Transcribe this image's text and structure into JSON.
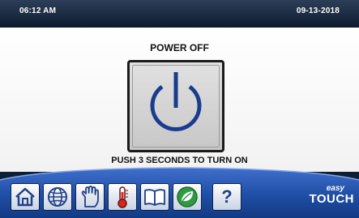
{
  "status_bar": {
    "time": "06:12 AM",
    "date": "09-13-2018"
  },
  "main": {
    "title": "POWER OFF",
    "hint": "PUSH 3 SECONDS TO TURN ON",
    "power_icon": "power-icon"
  },
  "nav": {
    "items": [
      {
        "icon": "home-icon"
      },
      {
        "icon": "globe-icon"
      },
      {
        "icon": "hand-icon"
      },
      {
        "icon": "thermometer-icon"
      },
      {
        "icon": "book-icon"
      },
      {
        "icon": "leaf-icon"
      },
      {
        "icon": "help-icon",
        "label": "?"
      }
    ]
  },
  "brand": {
    "line1": "easy",
    "line2": "TOUCH"
  },
  "colors": {
    "accent_blue": "#1a3c8d",
    "bar_blue": "#1f4ea5",
    "status_bar": "#1b2b41"
  }
}
